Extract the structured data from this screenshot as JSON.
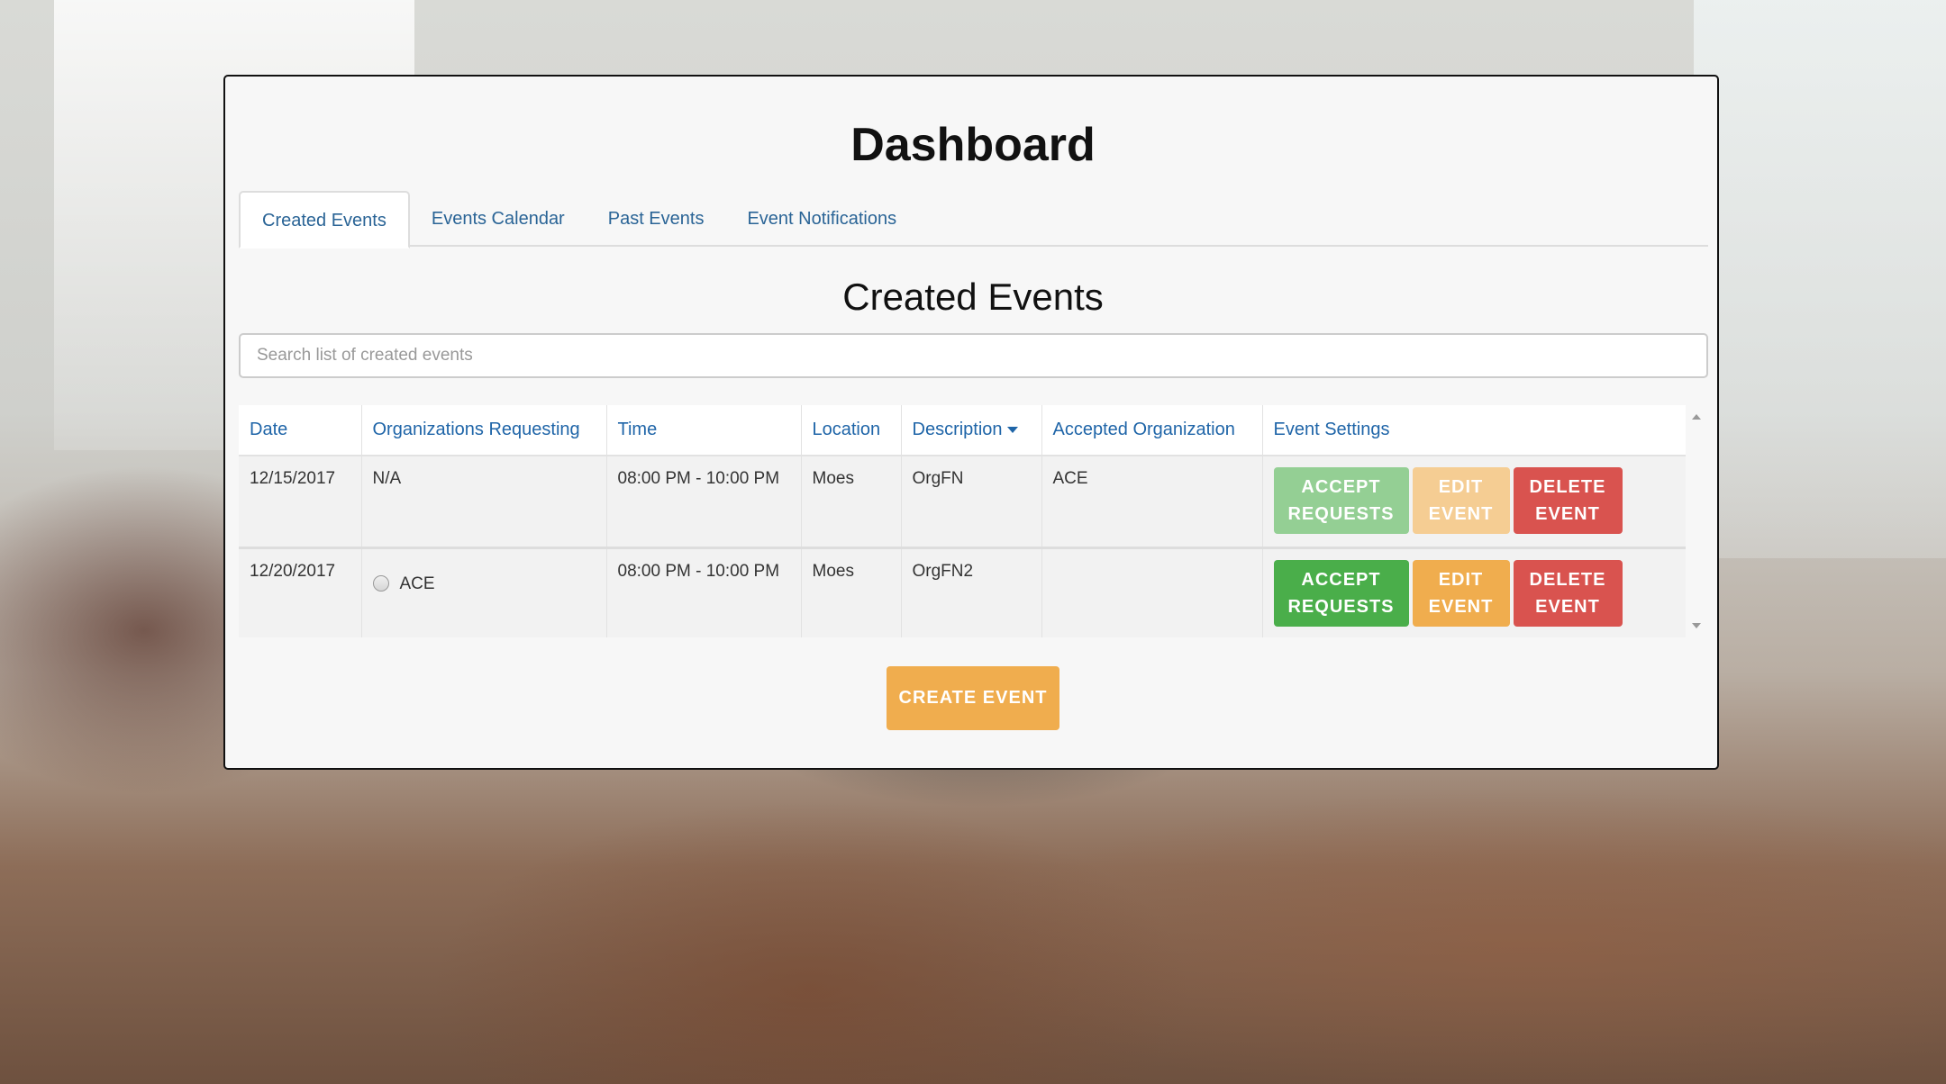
{
  "header": {
    "title": "Dashboard"
  },
  "tabs": [
    {
      "label": "Created Events",
      "active": true
    },
    {
      "label": "Events Calendar",
      "active": false
    },
    {
      "label": "Past Events",
      "active": false
    },
    {
      "label": "Event Notifications",
      "active": false
    }
  ],
  "section": {
    "title": "Created Events"
  },
  "search": {
    "placeholder": "Search list of created events",
    "value": ""
  },
  "table": {
    "columns": [
      "Date",
      "Organizations Requesting",
      "Time",
      "Location",
      "Description",
      "Accepted Organization",
      "Event Settings"
    ],
    "sort_indicator": "caret-down-icon on Description",
    "rows": [
      {
        "date": "12/15/2017",
        "organizations_requesting": "N/A",
        "time": "08:00 PM - 10:00 PM",
        "location": "Moes",
        "description": "OrgFN",
        "accepted_organization": "ACE",
        "accept_label": "ACCEPT REQUESTS",
        "edit_label": "EDIT EVENT",
        "delete_label": "DELETE EVENT",
        "buttons_dimmed": true
      },
      {
        "date": "12/20/2017",
        "organizations_requesting": "ACE",
        "time": "08:00 PM - 10:00 PM",
        "location": "Moes",
        "description": "OrgFN2",
        "accepted_organization": "",
        "accept_label": "ACCEPT REQUESTS",
        "edit_label": "EDIT EVENT",
        "delete_label": "DELETE EVENT",
        "buttons_dimmed": false
      }
    ]
  },
  "create_button": {
    "label": "CREATE EVENT"
  },
  "colors": {
    "accept": "#4aae4a",
    "edit": "#f0ad4e",
    "delete": "#d9534f",
    "link": "#1f65a8"
  }
}
